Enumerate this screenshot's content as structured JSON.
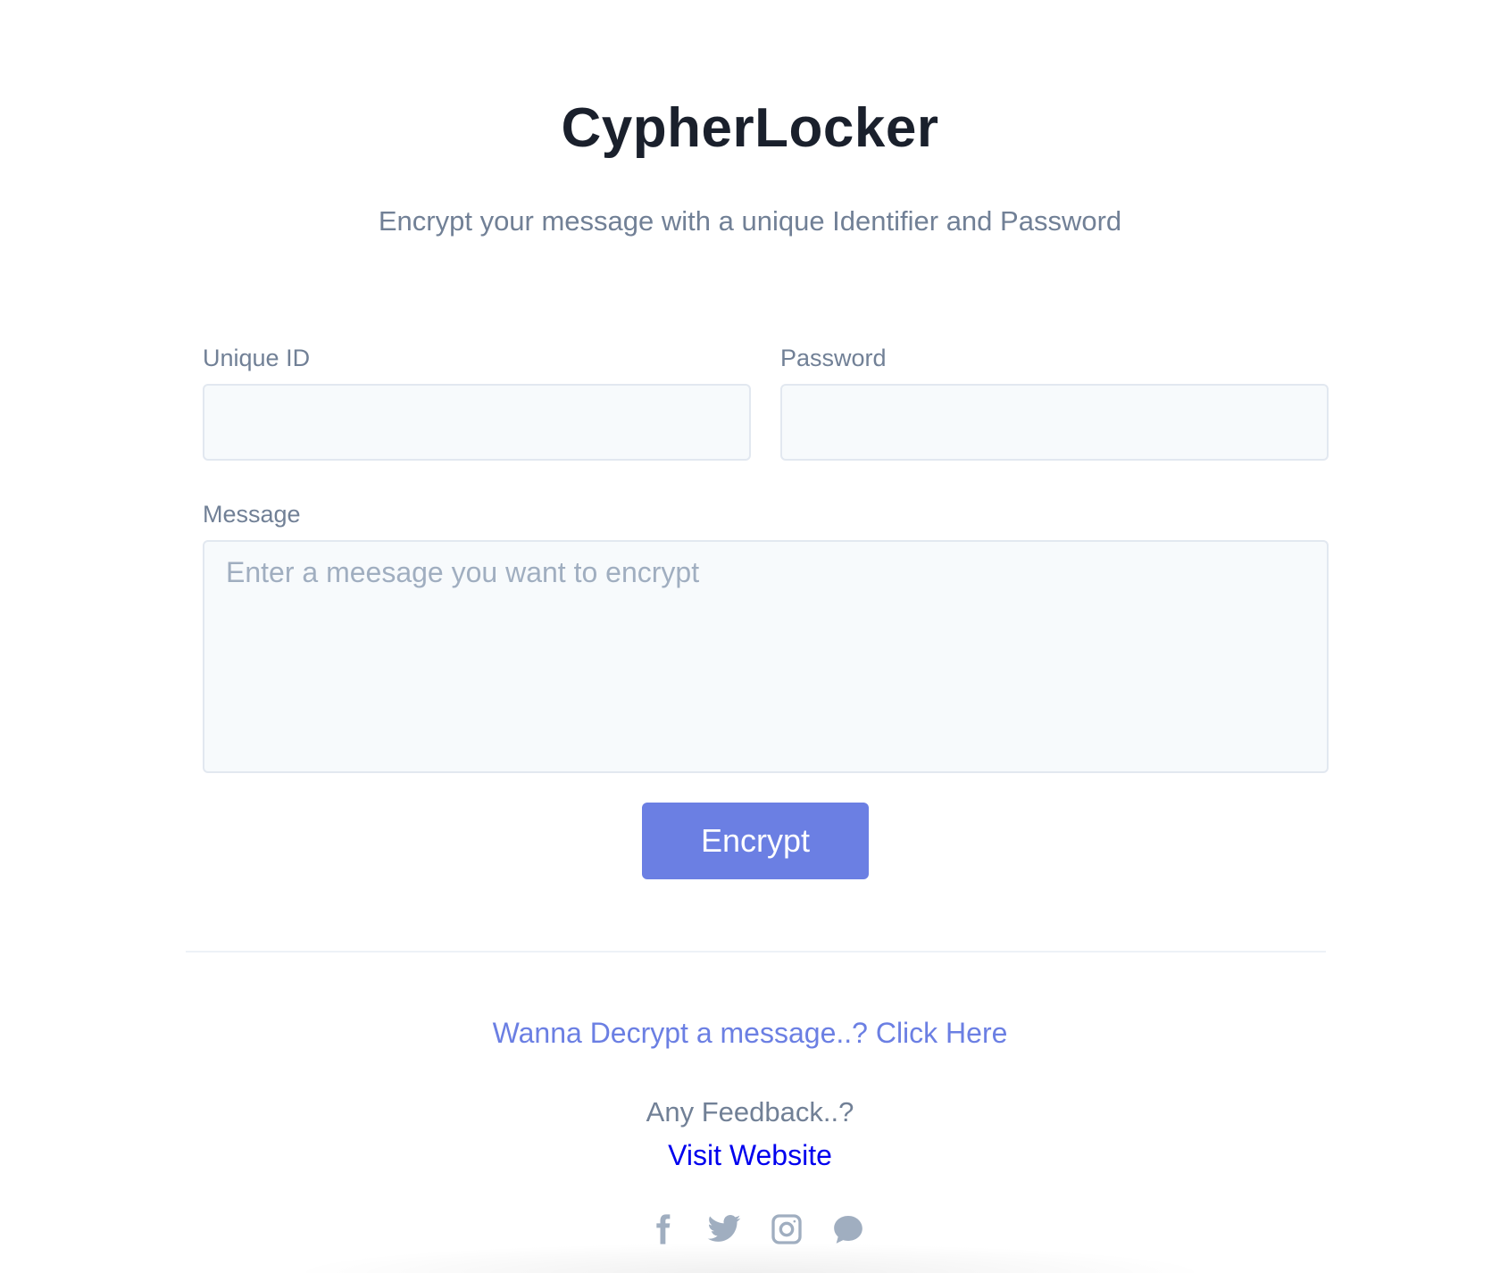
{
  "app": {
    "title": "CypherLocker",
    "subtitle": "Encrypt your message with a unique Identifier and Password"
  },
  "form": {
    "unique_id": {
      "label": "Unique ID",
      "value": "",
      "placeholder": ""
    },
    "password": {
      "label": "Password",
      "value": "",
      "placeholder": ""
    },
    "message": {
      "label": "Message",
      "value": "",
      "placeholder": "Enter a meesage you want to encrypt"
    },
    "submit_label": "Encrypt"
  },
  "footer": {
    "decrypt_link": "Wanna Decrypt a message..? Click Here",
    "feedback_text": "Any Feedback..?",
    "website_link": "Visit Website",
    "socials": [
      {
        "icon": "facebook-icon"
      },
      {
        "icon": "twitter-icon"
      },
      {
        "icon": "instagram-icon"
      },
      {
        "icon": "chat-icon"
      }
    ]
  },
  "colors": {
    "accent": "#6b7fe3",
    "heading": "#1a202c",
    "muted": "#718096",
    "link": "#0000ee",
    "icon": "#a0aec0"
  }
}
